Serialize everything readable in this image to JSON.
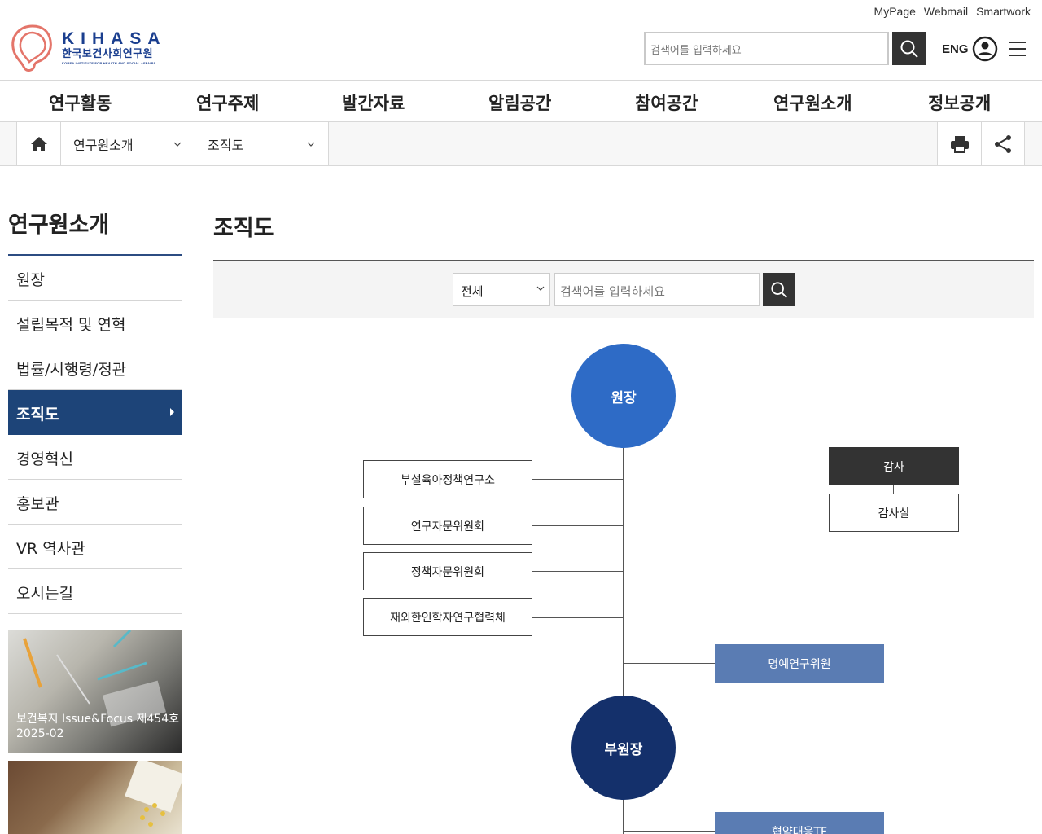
{
  "util_links": [
    "MyPage",
    "Webmail",
    "Smartwork"
  ],
  "logo": {
    "en": "KIHASA",
    "ko": "한국보건사회연구원",
    "sub": "KOREA INSTITUTE FOR HEALTH AND SOCIAL AFFAIRS"
  },
  "header": {
    "search_placeholder": "검색어를 입력하세요",
    "eng": "ENG"
  },
  "gnb": [
    "연구활동",
    "연구주제",
    "발간자료",
    "알림공간",
    "참여공간",
    "연구원소개",
    "정보공개"
  ],
  "breadcrumb": {
    "level1": "연구원소개",
    "level2": "조직도"
  },
  "lnb": {
    "title": "연구원소개",
    "items": [
      "원장",
      "설립목적 및 연혁",
      "법률/시행령/정관",
      "조직도",
      "경영혁신",
      "홍보관",
      "VR 역사관",
      "오시는길"
    ],
    "active_index": 3
  },
  "banners": [
    {
      "line1": "보건복지 Issue&Focus 제454호",
      "line2": "2025-02"
    }
  ],
  "main": {
    "title": "조직도",
    "select_value": "전체",
    "search_placeholder": "검색어를 입력하세요"
  },
  "org": {
    "president": "원장",
    "left_boxes": [
      "부설육아정책연구소",
      "연구자문위원회",
      "정책자문위원회",
      "재외한인학자연구협력체"
    ],
    "audit": "감사",
    "audit_office": "감사실",
    "honorary": "명예연구위원",
    "vice_president": "부원장",
    "bottom_box": "협약대응TF"
  },
  "colors": {
    "brand_blue": "#1b3f8f",
    "lnb_active": "#1d4478",
    "president_circle": "#2e6bc6",
    "vice_circle": "#14306b",
    "blue_box": "#5a7cb3",
    "dark_box": "#333333"
  }
}
